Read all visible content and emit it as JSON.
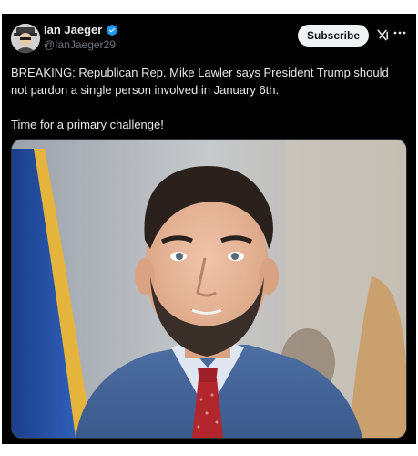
{
  "author": {
    "display_name": "Ian Jaeger",
    "handle": "@IanJaeger29",
    "verified": true,
    "avatar_icon": "avatar-photo"
  },
  "actions": {
    "subscribe_label": "Subscribe",
    "grok_icon": "grok-icon",
    "more_icon": "more-icon"
  },
  "tweet": {
    "paragraphs": [
      "BREAKING: Republican Rep. Mike Lawler says President Trump should not pardon a single person involved in January 6th.",
      "Time for a primary challenge!"
    ]
  },
  "media": {
    "type": "photo",
    "subject": "man in suit and red tie in front of flag"
  },
  "colors": {
    "background": "#000000",
    "text": "#e7e9ea",
    "secondary_text": "#71767b",
    "verified_blue": "#1d9bf0",
    "button_bg": "#eff3f4"
  }
}
